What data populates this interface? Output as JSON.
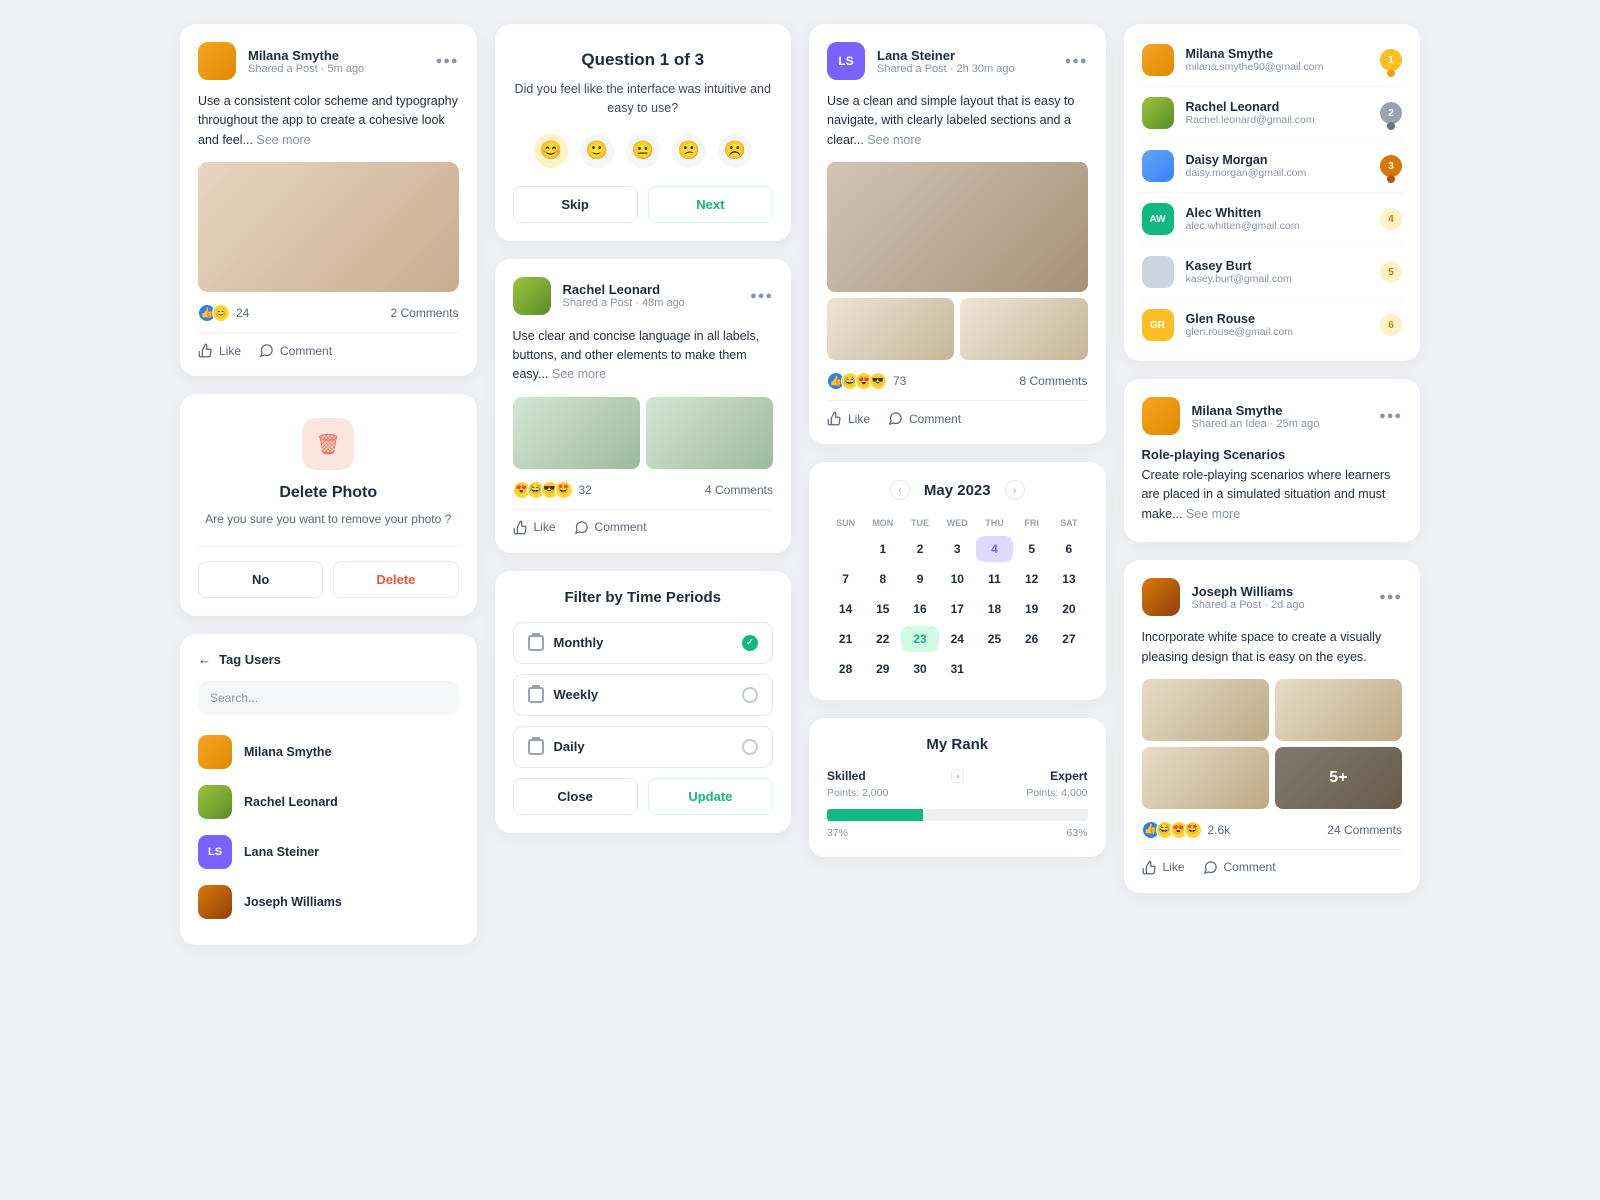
{
  "posts": {
    "p1": {
      "name": "Milana Smythe",
      "meta": "Shared a Post  ·  5m ago",
      "body": "Use a consistent color scheme and typography throughout the app to create a cohesive look and feel... ",
      "seemore": "See more",
      "count": "24",
      "comments": "2 Comments"
    },
    "p2": {
      "name": "Rachel Leonard",
      "meta": "Shared a Post  ·  48m ago",
      "body": "Use clear and concise language in all labels, buttons, and other elements to make them easy... ",
      "seemore": "See more",
      "count": "32",
      "comments": "4 Comments"
    },
    "p3": {
      "name": "Lana Steiner",
      "meta": "Shared a Post  ·  2h 30m ago",
      "body": "Use a clean and simple layout that is easy to navigate, with clearly labeled sections and a clear... ",
      "seemore": "See more",
      "count": "73",
      "comments": "8 Comments"
    },
    "p4": {
      "name": "Joseph Williams",
      "meta": "Shared a Post  ·  2d ago",
      "body": "Incorporate white space to create a visually pleasing design that is easy on the eyes.",
      "morecount": "5+",
      "count": "2.6k",
      "comments": "24 Comments"
    }
  },
  "actions": {
    "like": "Like",
    "comment": "Comment"
  },
  "question": {
    "title": "Question 1 of 3",
    "text": "Did you feel like the interface was intuitive and easy to use?",
    "skip": "Skip",
    "next": "Next"
  },
  "deleteModal": {
    "title": "Delete Photo",
    "text": "Are you sure you want to remove your photo ?",
    "no": "No",
    "delete": "Delete"
  },
  "tagUsers": {
    "title": "Tag Users",
    "placeholder": "Search...",
    "u1": "Milana Smythe",
    "u2": "Rachel Leonard",
    "u3": "Lana Steiner",
    "u4": "Joseph Williams"
  },
  "filter": {
    "title": "Filter by Time Periods",
    "o1": "Monthly",
    "o2": "Weekly",
    "o3": "Daily",
    "close": "Close",
    "update": "Update"
  },
  "calendar": {
    "title": "May 2023",
    "dow": [
      "SUN",
      "MON",
      "TUE",
      "WED",
      "THU",
      "FRI",
      "SAT"
    ]
  },
  "rank": {
    "title": "My Rank",
    "left": "Skilled",
    "right": "Expert",
    "leftpts": "Points: 2,000",
    "rightpts": "Points: 4,000",
    "leftpct": "37%",
    "rightpct": "63%"
  },
  "leaderboard": [
    {
      "name": "Milana Smythe",
      "email": "milana.smythe90@gmail.com",
      "rank": "1"
    },
    {
      "name": "Rachel Leonard",
      "email": "Rachel.leonard@gmail.com",
      "rank": "2"
    },
    {
      "name": "Daisy Morgan",
      "email": "daisy.morgan@gmail.com",
      "rank": "3"
    },
    {
      "name": "Alec Whitten",
      "email": "alec.whitten@gmail.com",
      "rank": "4"
    },
    {
      "name": "Kasey Burt",
      "email": "kasey.burt@gmail.com",
      "rank": "5"
    },
    {
      "name": "Glen Rouse",
      "email": "glen.rouse@gmail.com",
      "rank": "6"
    }
  ],
  "idea": {
    "name": "Milana Smythe",
    "meta": "Shared an Idea  ·  25m ago",
    "title": "Role-playing Scenarios",
    "body": "Create role-playing scenarios where learners are placed in a simulated situation and must make... ",
    "seemore": "See more"
  }
}
